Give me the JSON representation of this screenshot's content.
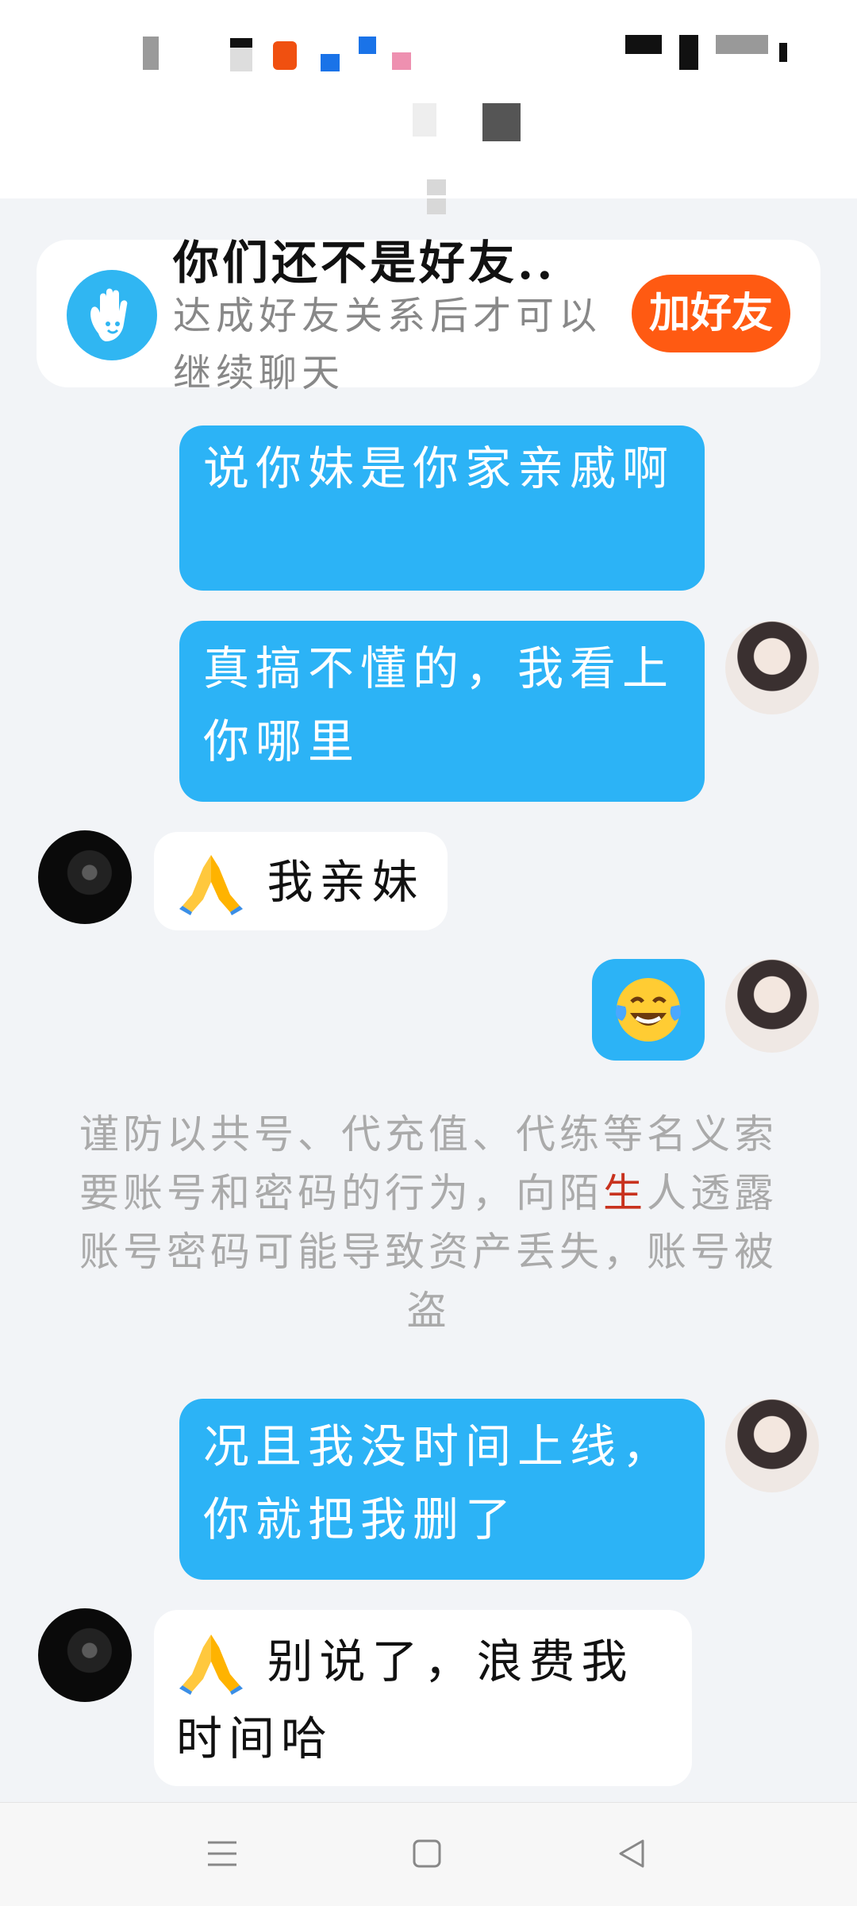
{
  "notice": {
    "title": "你们还不是好友..",
    "description": "达成好友关系后才可以继续聊天",
    "add_button": "加好友",
    "icon": "waving-hand-icon"
  },
  "messages": [
    {
      "side": "out",
      "text": "说你妹是你家亲戚啊"
    },
    {
      "side": "out",
      "text": "真搞不懂的，我看上你哪里"
    },
    {
      "side": "in",
      "emoji": "folded-hands-icon",
      "text": "我亲妹"
    },
    {
      "side": "out",
      "emoji": "tears-of-joy-icon",
      "text": ""
    },
    {
      "side": "out",
      "text": "况且我没时间上线，你就把我删了"
    },
    {
      "side": "in",
      "emoji": "folded-hands-icon",
      "text": "别说了，浪费我时间哈"
    }
  ],
  "warning": {
    "before": "谨防以共号、代充值、代练等名义索要账号和密码的行为，向陌",
    "highlight": "生",
    "after": "人透露账号密码可能导致资产丢失，账号被盗"
  },
  "colors": {
    "outgoing_bubble": "#2cb3f6",
    "add_button": "#ff5a12",
    "background": "#f2f4f7",
    "warning_highlight": "#c8321e"
  },
  "navbar": {
    "menu": "menu-icon",
    "home": "home-square-icon",
    "back": "back-triangle-icon"
  }
}
